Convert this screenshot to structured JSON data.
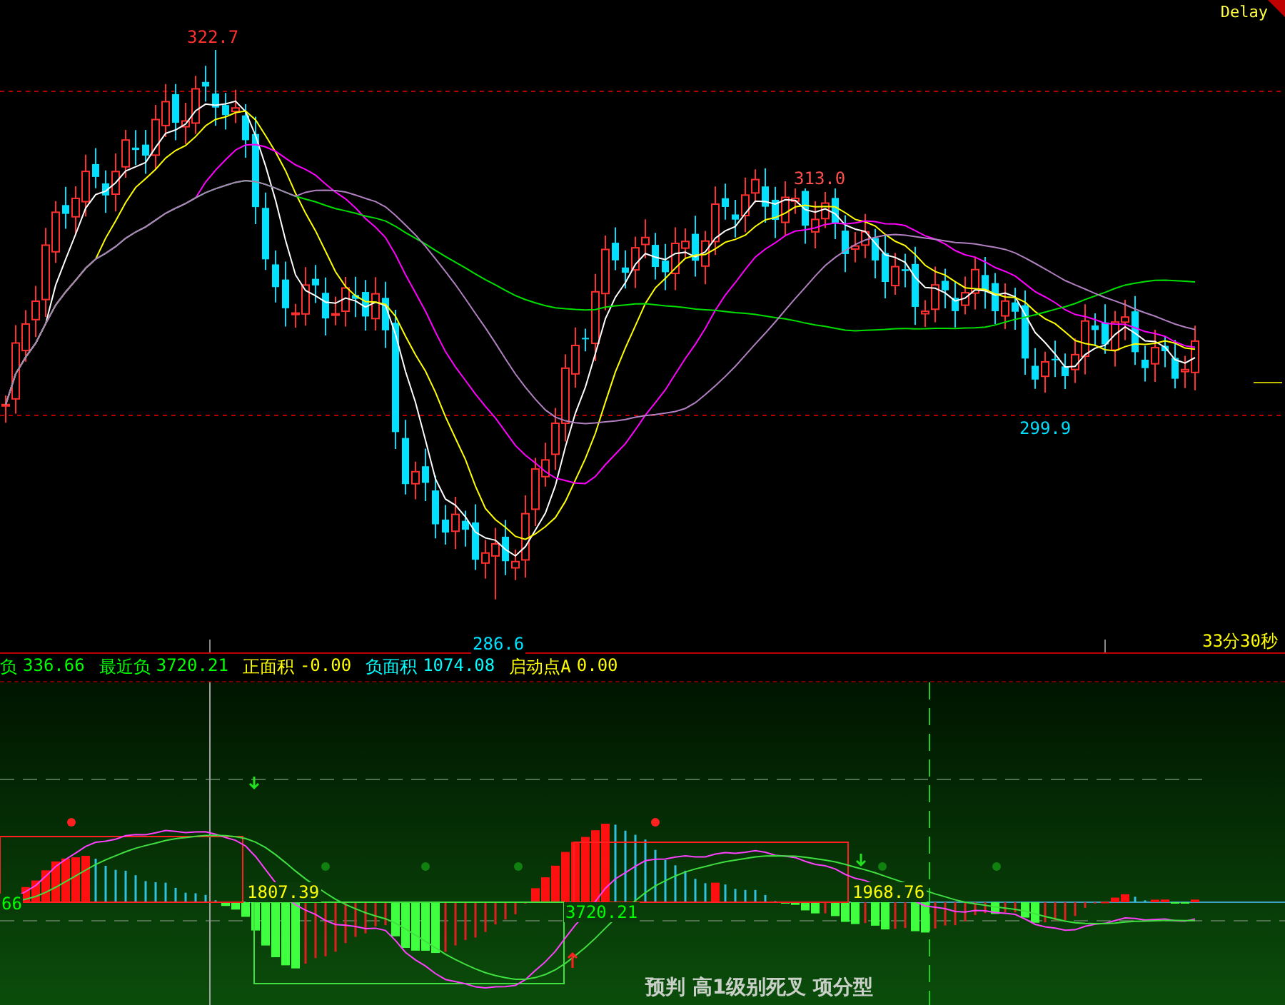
{
  "main_chart": {
    "badge": "Delay",
    "high_label": "322.7",
    "peak_label": "313.0",
    "trough_label": "299.9",
    "low_label": "286.6",
    "timer": "33分30秒"
  },
  "indicator": {
    "legend": [
      {
        "label": "负",
        "value": "336.66",
        "color": "#00ff00"
      },
      {
        "label": "最近负",
        "value": "3720.21",
        "color": "#00ff00"
      },
      {
        "label": "正面积",
        "value": "-0.00",
        "color": "#ffff00"
      },
      {
        "label": "负面积",
        "value": "1074.08",
        "color": "#00ffff"
      },
      {
        "label": "启动点A",
        "value": "0.00",
        "color": "#ffff00"
      }
    ],
    "value_labels": [
      {
        "text": "66",
        "color": "#00ff00"
      },
      {
        "text": "1807.39",
        "color": "#ffff00"
      },
      {
        "text": "3720.21",
        "color": "#00ff00"
      },
      {
        "text": "1968.76",
        "color": "#ffff00"
      }
    ],
    "signal_text": "预判 高1级别死叉 项分型"
  }
}
